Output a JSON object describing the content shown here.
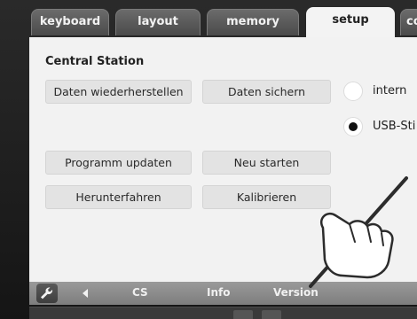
{
  "tabs": [
    {
      "label": "keyboard",
      "active": false
    },
    {
      "label": "layout",
      "active": false
    },
    {
      "label": "memory",
      "active": false
    },
    {
      "label": "setup",
      "active": true
    },
    {
      "label": "co",
      "active": false
    }
  ],
  "setup": {
    "title": "Central Station",
    "buttons": {
      "restore": "Daten wiederherstellen",
      "backup": "Daten sichern",
      "update": "Programm updaten",
      "restart": "Neu starten",
      "shutdown": "Herunterfahren",
      "calibrate": "Kalibrieren"
    },
    "storage_options": [
      {
        "label": "intern",
        "selected": false
      },
      {
        "label": "USB-Sti",
        "selected": true
      }
    ]
  },
  "bottom_bar": {
    "breadcrumbs": [
      "CS",
      "Info",
      "Version"
    ]
  },
  "icons": {
    "wrench": "wrench-icon",
    "back": "back-arrow-icon",
    "stylus_hand": "stylus-hand-icon"
  },
  "colors": {
    "panel_bg": "#f2f2f2",
    "tab_active_bg": "#f3f3f3",
    "tab_inactive_bg": "#5a5a5a",
    "button_bg": "#e3e3e3",
    "bottom_bar_bg": "#8a8a8a"
  }
}
